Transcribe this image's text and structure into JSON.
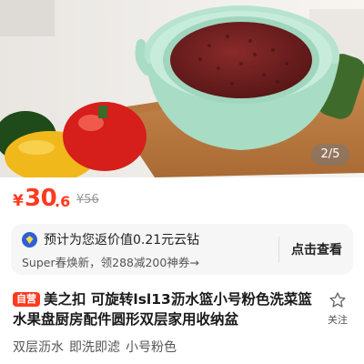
{
  "gallery": {
    "counter": "2/5"
  },
  "price": {
    "currency": "¥",
    "integer": "30",
    "decimal": ".6",
    "original": "¥56",
    "color": "#ff3a1f"
  },
  "rebate": {
    "icon": "rebate-coin-icon",
    "line1": "预计为您返价值0.21元云钻",
    "line2": "Super春焕新，领288减200神券→",
    "action": "点击查看"
  },
  "product": {
    "badge": "自营",
    "title": "美之扣 可旋转lsl13沥水篮小号粉色洗菜篮水果盘厨房配件圆形双层家用收纳盆",
    "favorite_label": "关注",
    "favorite_icon": "star-icon",
    "tags": [
      "双层沥水",
      "即洗即滤",
      "小号粉色"
    ]
  }
}
